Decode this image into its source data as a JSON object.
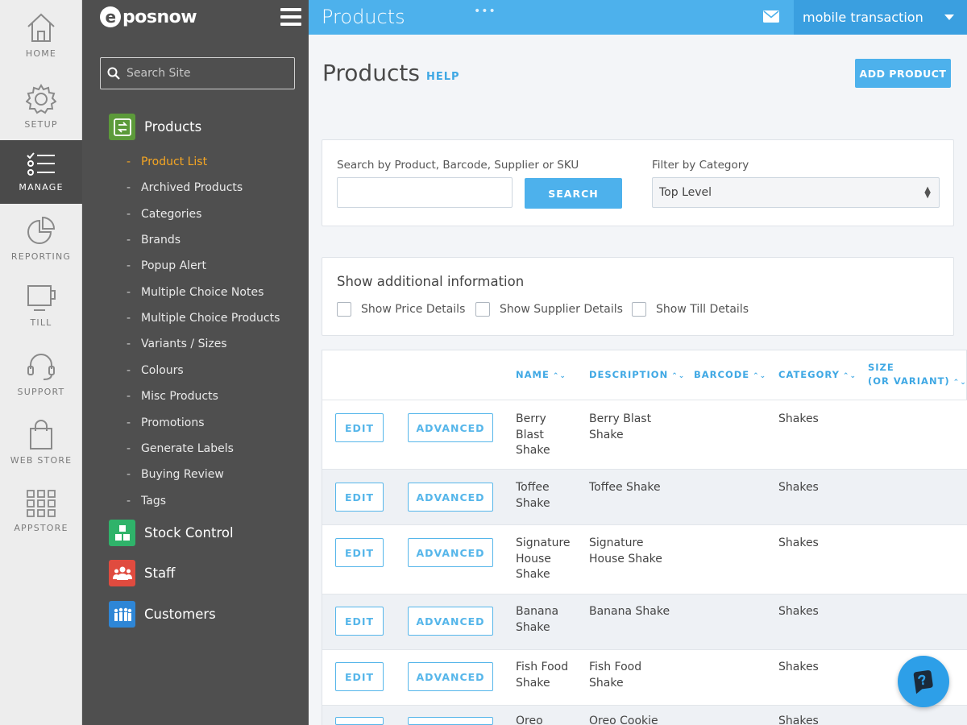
{
  "rail": [
    {
      "label": "HOME",
      "icon": "home-icon"
    },
    {
      "label": "SETUP",
      "icon": "gear-icon"
    },
    {
      "label": "MANAGE",
      "icon": "list-icon",
      "active": true
    },
    {
      "label": "REPORTING",
      "icon": "pie-chart-icon"
    },
    {
      "label": "TILL",
      "icon": "till-icon"
    },
    {
      "label": "SUPPORT",
      "icon": "headset-icon"
    },
    {
      "label": "WEB STORE",
      "icon": "shopping-bag-icon"
    },
    {
      "label": "APPSTORE",
      "icon": "grid-icon"
    }
  ],
  "sidebar": {
    "logo_text": "posnow",
    "logo_mark": "e",
    "search_placeholder": "Search Site",
    "sections": [
      {
        "label": "Products",
        "icon": "products-icon",
        "color": "#5c9a3a"
      },
      {
        "label": "Stock Control",
        "icon": "stock-control-icon",
        "color": "#2fb36a"
      },
      {
        "label": "Staff",
        "icon": "staff-icon",
        "color": "#e04b3f"
      },
      {
        "label": "Customers",
        "icon": "customers-icon",
        "color": "#2e86d6"
      }
    ],
    "product_items": [
      "Product List",
      "Archived Products",
      "Categories",
      "Brands",
      "Popup Alert",
      "Multiple Choice Notes",
      "Multiple Choice Products",
      "Variants / Sizes",
      "Colours",
      "Misc Products",
      "Promotions",
      "Generate Labels",
      "Buying Review",
      "Tags"
    ],
    "active_item": "Product List",
    "dash": "-"
  },
  "topbar": {
    "title": "Products",
    "dots": "•••",
    "account": "mobile transaction"
  },
  "main": {
    "page_title": "Products",
    "help": "HELP",
    "add_product": "ADD PRODUCT",
    "search_label": "Search by Product, Barcode, Supplier or SKU",
    "search_value": "",
    "search_button": "SEARCH",
    "filter_label": "Filter by Category",
    "filter_value": "Top Level",
    "info_title": "Show additional information",
    "checks": [
      "Show Price Details",
      "Show Supplier Details",
      "Show Till Details"
    ]
  },
  "table": {
    "headers": {
      "name": "NAME",
      "description": "DESCRIPTION",
      "barcode": "BARCODE",
      "category": "CATEGORY",
      "size_line1": "SIZE",
      "size_line2": "(OR VARIANT)"
    },
    "edit_label": "EDIT",
    "advanced_label": "ADVANCED",
    "rows": [
      {
        "name": [
          "Berry",
          "Blast",
          "Shake"
        ],
        "description": [
          "Berry Blast",
          "Shake"
        ],
        "barcode": "",
        "category": "Shakes"
      },
      {
        "name": [
          "Toffee",
          "Shake"
        ],
        "description": [
          "Toffee Shake"
        ],
        "barcode": "",
        "category": "Shakes"
      },
      {
        "name": [
          "Signature",
          "House",
          "Shake"
        ],
        "description": [
          "Signature",
          "House Shake"
        ],
        "barcode": "",
        "category": "Shakes"
      },
      {
        "name": [
          "Banana",
          "Shake"
        ],
        "description": [
          "Banana Shake"
        ],
        "barcode": "",
        "category": "Shakes"
      },
      {
        "name": [
          "Fish Food",
          "Shake"
        ],
        "description": [
          "Fish Food",
          "Shake"
        ],
        "barcode": "",
        "category": "Shakes"
      },
      {
        "name": [
          "Oreo"
        ],
        "description": [
          "Oreo Cookie"
        ],
        "barcode": "",
        "category": "Shakes"
      }
    ]
  },
  "icons": {
    "search": "search-icon",
    "mail": "mail-icon",
    "chat": "chat-icon"
  },
  "colors": {
    "accent": "#4db1ec",
    "active_nav": "#f5a623",
    "sidebar": "#4f4f4f"
  }
}
